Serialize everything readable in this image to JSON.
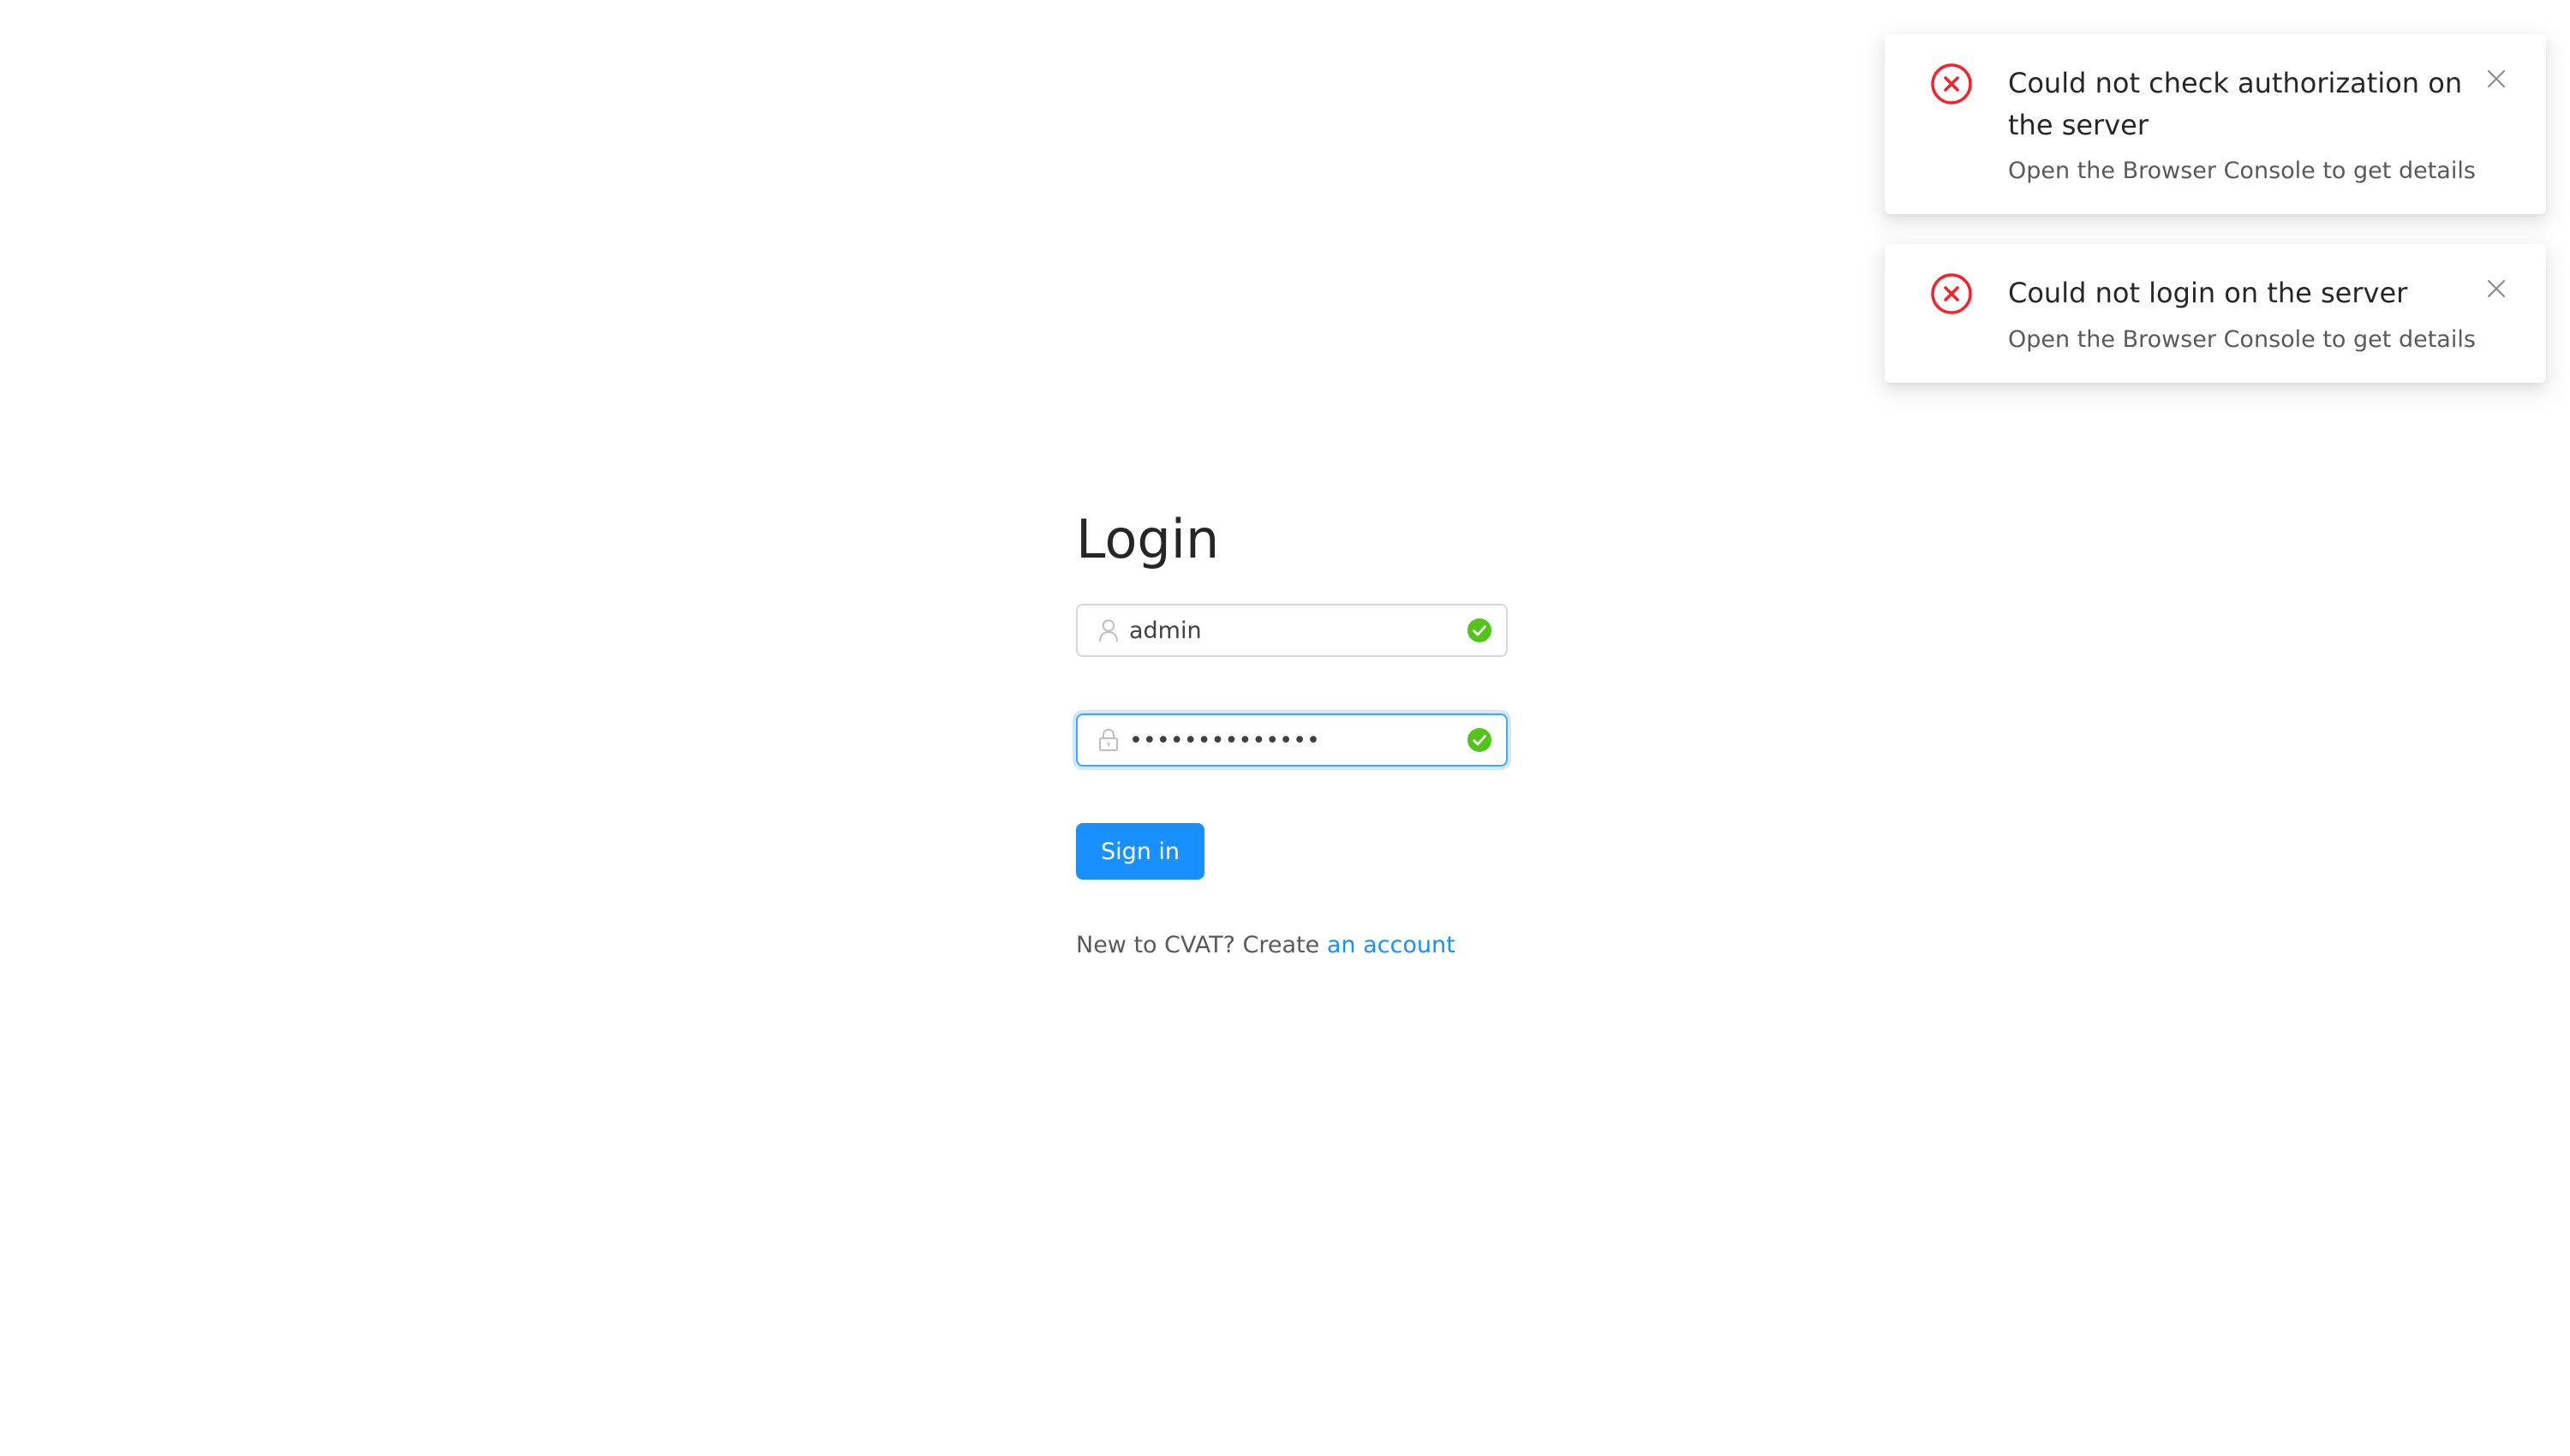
{
  "login": {
    "title": "Login",
    "username_value": "admin",
    "password_masked": "••••••••••••••",
    "signin_label": "Sign in",
    "register_prefix": "New to CVAT? Create ",
    "register_link": "an account"
  },
  "notifications": [
    {
      "title": "Could not check authorization on the server",
      "description": "Open the Browser Console to get details"
    },
    {
      "title": "Could not login on the server",
      "description": "Open the Browser Console to get details"
    }
  ],
  "colors": {
    "primary": "#1890ff",
    "error": "#f5222d",
    "success": "#52c41a"
  },
  "icons": {
    "username_prefix": "user-icon",
    "password_prefix": "lock-icon",
    "field_valid": "check-circle-icon",
    "notification_error": "close-circle-icon",
    "notification_close": "close-icon"
  }
}
